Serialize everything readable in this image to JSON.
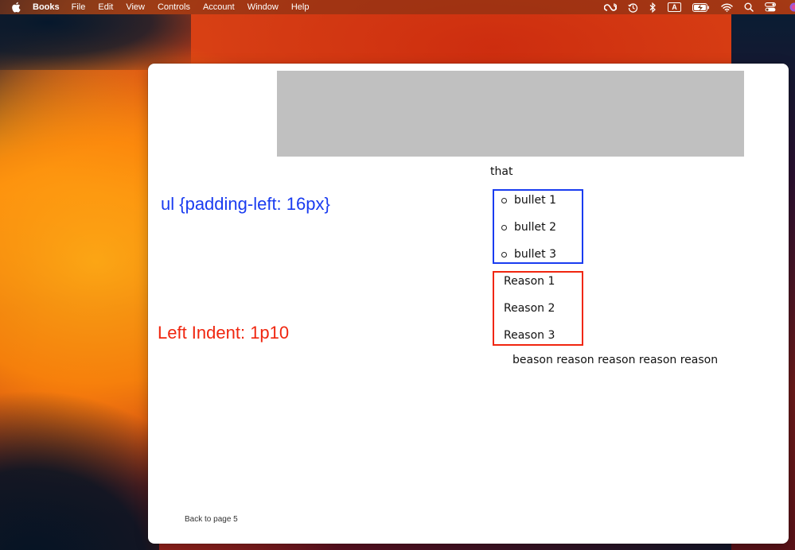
{
  "menubar": {
    "apple_icon": "apple-logo-icon",
    "app_name": "Books",
    "items": [
      "File",
      "Edit",
      "View",
      "Controls",
      "Account",
      "Window",
      "Help"
    ],
    "status_icons": [
      "creative-cloud-icon",
      "time-machine-icon",
      "bluetooth-icon",
      "input-source-icon",
      "battery-charging-icon",
      "wifi-icon",
      "spotlight-search-icon",
      "control-center-icon",
      "siri-icon"
    ],
    "input_source_label": "A"
  },
  "book": {
    "image_placeholder_color": "#c0c0c0",
    "annotations": {
      "blue": {
        "text": "ul {padding-left: 16px}",
        "color": "#1a3cf0"
      },
      "red": {
        "text": "Left Indent: 1p10",
        "color": "#f0260f"
      }
    },
    "lead_text": "that",
    "bullets": [
      "bullet 1",
      "bullet 2",
      "bullet 3"
    ],
    "reasons": [
      "Reason 1",
      "Reason 2",
      "Reason 3"
    ],
    "trailing_text": "beason reason reason reason reason",
    "back_link": "Back to page 5"
  }
}
